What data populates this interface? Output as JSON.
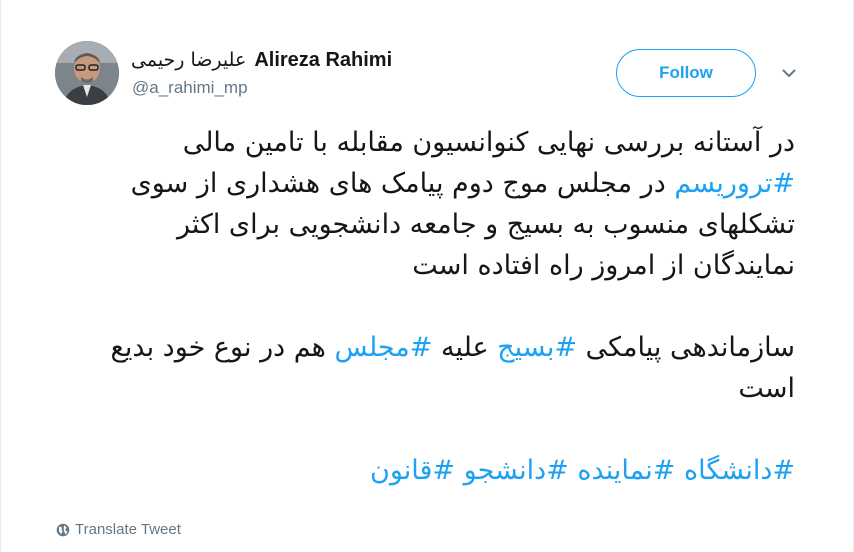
{
  "author": {
    "display_name_fa": "علیرضا رحیمی",
    "display_name_en": "Alireza Rahimi",
    "handle": "@a_rahimi_mp"
  },
  "actions": {
    "follow_label": "Follow",
    "translate_label": "Translate Tweet"
  },
  "tweet": {
    "para1_text": "در آستانه بررسی نهایی کنوانسیون مقابله با تامین مالی ",
    "para1_hashtag": "#تروریسم",
    "para1_rest": " در مجلس موج دوم پیامک های هشداری از سوی تشکلهای منسوب به بسیج و جامعه دانشجویی برای اکثر نمایندگان از امروز راه افتاده است",
    "para2_a": "سازماندهی پیامکی ",
    "para2_hashtag1": "#بسیج",
    "para2_b": " علیه ",
    "para2_hashtag2": "#مجلس",
    "para2_c": " هم در نوع خود بدیع است",
    "tags": [
      "#دانشگاه",
      "#نماینده",
      "#دانشجو",
      "#قانون"
    ]
  },
  "colors": {
    "accent": "#1da1f2",
    "text": "#14171a",
    "muted": "#657786"
  },
  "icons": {
    "caret": "chevron-down-icon",
    "translate": "globe-icon"
  }
}
